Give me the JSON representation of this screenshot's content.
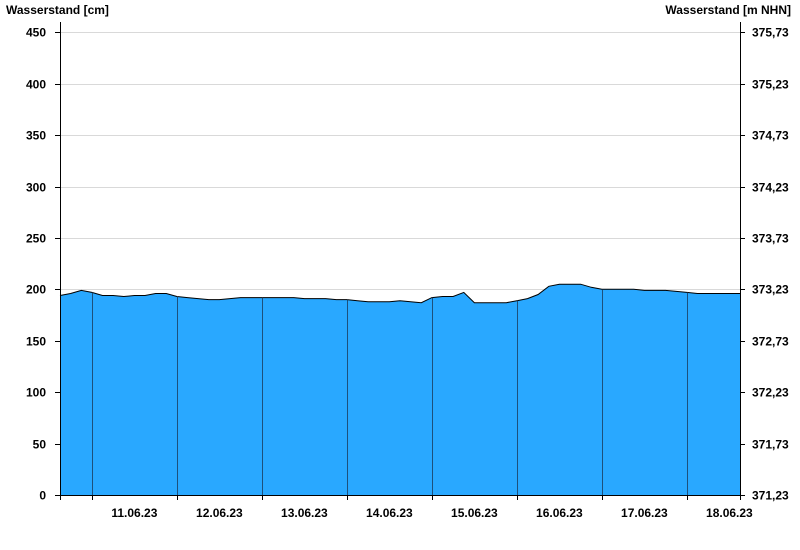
{
  "chart_data": {
    "type": "area",
    "title": "",
    "ylabel_left": "Wasserstand [cm]",
    "ylabel_right": "Wasserstand [m NHN]",
    "ylim": [
      0,
      460
    ],
    "yticks_left": [
      0,
      50,
      100,
      150,
      200,
      250,
      300,
      350,
      400,
      450
    ],
    "yticks_right": [
      "371,23",
      "371,73",
      "372,23",
      "372,73",
      "373,23",
      "373,73",
      "374,23",
      "374,73",
      "375,23",
      "375,73"
    ],
    "x_range": [
      "10.06.23 15:00",
      "18.06.23 15:00"
    ],
    "x_tick_labels": [
      "11.06.23",
      "12.06.23",
      "13.06.23",
      "14.06.23",
      "15.06.23",
      "16.06.23",
      "17.06.23",
      "18.06.23"
    ],
    "grid": true,
    "fill_color": "#29a8ff",
    "line_color": "#000000",
    "series": [
      {
        "x": [
          "10.06.23 15:00",
          "10.06.23 18:00",
          "10.06.23 21:00",
          "11.06.23 00:00",
          "11.06.23 03:00",
          "11.06.23 06:00",
          "11.06.23 09:00",
          "11.06.23 12:00",
          "11.06.23 15:00",
          "11.06.23 18:00",
          "11.06.23 21:00",
          "12.06.23 00:00",
          "12.06.23 03:00",
          "12.06.23 06:00",
          "12.06.23 09:00",
          "12.06.23 12:00",
          "12.06.23 15:00",
          "12.06.23 18:00",
          "12.06.23 21:00",
          "13.06.23 00:00",
          "13.06.23 03:00",
          "13.06.23 06:00",
          "13.06.23 09:00",
          "13.06.23 12:00",
          "13.06.23 15:00",
          "13.06.23 18:00",
          "13.06.23 21:00",
          "14.06.23 00:00",
          "14.06.23 03:00",
          "14.06.23 06:00",
          "14.06.23 09:00",
          "14.06.23 12:00",
          "14.06.23 15:00",
          "14.06.23 18:00",
          "14.06.23 21:00",
          "15.06.23 00:00",
          "15.06.23 03:00",
          "15.06.23 06:00",
          "15.06.23 09:00",
          "15.06.23 12:00",
          "15.06.23 15:00",
          "15.06.23 18:00",
          "15.06.23 21:00",
          "16.06.23 00:00",
          "16.06.23 03:00",
          "16.06.23 06:00",
          "16.06.23 09:00",
          "16.06.23 12:00",
          "16.06.23 15:00",
          "16.06.23 18:00",
          "16.06.23 21:00",
          "17.06.23 00:00",
          "17.06.23 03:00",
          "17.06.23 06:00",
          "17.06.23 09:00",
          "17.06.23 12:00",
          "17.06.23 15:00",
          "17.06.23 18:00",
          "17.06.23 21:00",
          "18.06.23 00:00",
          "18.06.23 03:00",
          "18.06.23 06:00",
          "18.06.23 09:00",
          "18.06.23 12:00",
          "18.06.23 15:00"
        ],
        "values": [
          194,
          196,
          199,
          197,
          194,
          194,
          193,
          194,
          194,
          196,
          196,
          193,
          192,
          191,
          190,
          190,
          191,
          192,
          192,
          192,
          192,
          192,
          192,
          191,
          191,
          191,
          190,
          190,
          189,
          188,
          188,
          188,
          189,
          188,
          187,
          192,
          193,
          193,
          197,
          187,
          187,
          187,
          187,
          189,
          191,
          195,
          203,
          205,
          205,
          205,
          202,
          200,
          200,
          200,
          200,
          199,
          199,
          199,
          198,
          197,
          196,
          196,
          196,
          196,
          196
        ]
      }
    ]
  }
}
